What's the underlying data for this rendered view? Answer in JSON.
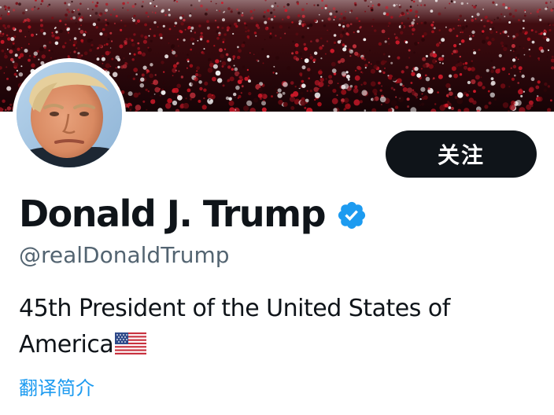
{
  "profile": {
    "display_name": "Donald J. Trump",
    "handle": "@realDonaldTrump",
    "verified": true,
    "bio_line1": "45th President of the United States of",
    "bio_line2": "America",
    "bio_emoji": "us-flag-icon",
    "translate_bio": "翻译简介"
  },
  "actions": {
    "follow_label": "关注"
  },
  "colors": {
    "follow_button_bg": "#0f1419",
    "verified_badge": "#1d9bf0",
    "link": "#1d9bf0",
    "handle_text": "#536471",
    "banner_crowd_red": "#b3121d"
  },
  "icons": {
    "verified": "verified-badge-icon",
    "avatar": "profile-avatar",
    "banner": "header-banner-crowd"
  }
}
